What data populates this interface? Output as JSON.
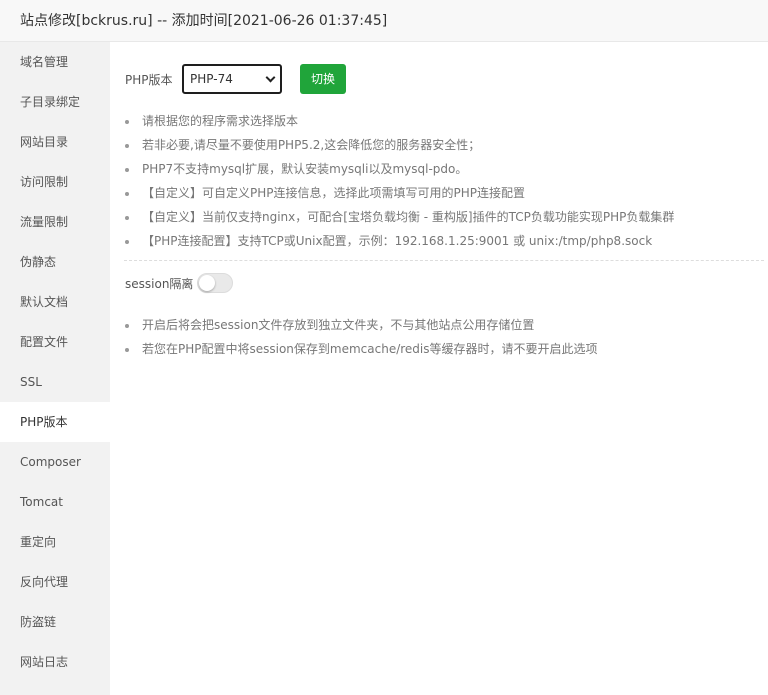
{
  "window": {
    "title": "站点修改[bckrus.ru] -- 添加时间[2021-06-26 01:37:45]"
  },
  "sidebar": {
    "items": [
      {
        "label": "域名管理"
      },
      {
        "label": "子目录绑定"
      },
      {
        "label": "网站目录"
      },
      {
        "label": "访问限制"
      },
      {
        "label": "流量限制"
      },
      {
        "label": "伪静态"
      },
      {
        "label": "默认文档"
      },
      {
        "label": "配置文件"
      },
      {
        "label": "SSL"
      },
      {
        "label": "PHP版本",
        "active": true
      },
      {
        "label": "Composer"
      },
      {
        "label": "Tomcat"
      },
      {
        "label": "重定向"
      },
      {
        "label": "反向代理"
      },
      {
        "label": "防盗链"
      },
      {
        "label": "网站日志"
      }
    ]
  },
  "php": {
    "label": "PHP版本",
    "selected": "PHP-74",
    "switch_label": "切换",
    "tips": [
      "请根据您的程序需求选择版本",
      "若非必要,请尽量不要使用PHP5.2,这会降低您的服务器安全性；",
      "PHP7不支持mysql扩展，默认安装mysqli以及mysql-pdo。",
      "【自定义】可自定义PHP连接信息，选择此项需填写可用的PHP连接配置",
      "【自定义】当前仅支持nginx，可配合[宝塔负载均衡 - 重构版]插件的TCP负载功能实现PHP负载集群",
      "【PHP连接配置】支持TCP或Unix配置，示例：192.168.1.25:9001 或 unix:/tmp/php8.sock"
    ]
  },
  "session": {
    "label": "session隔离",
    "enabled": false,
    "tips": [
      "开启后将会把session文件存放到独立文件夹，不与其他站点公用存储位置",
      "若您在PHP配置中将session保存到memcache/redis等缓存器时，请不要开启此选项"
    ]
  },
  "colors": {
    "accent": "#20a53a",
    "sidebar_bg": "#f2f2f2"
  }
}
